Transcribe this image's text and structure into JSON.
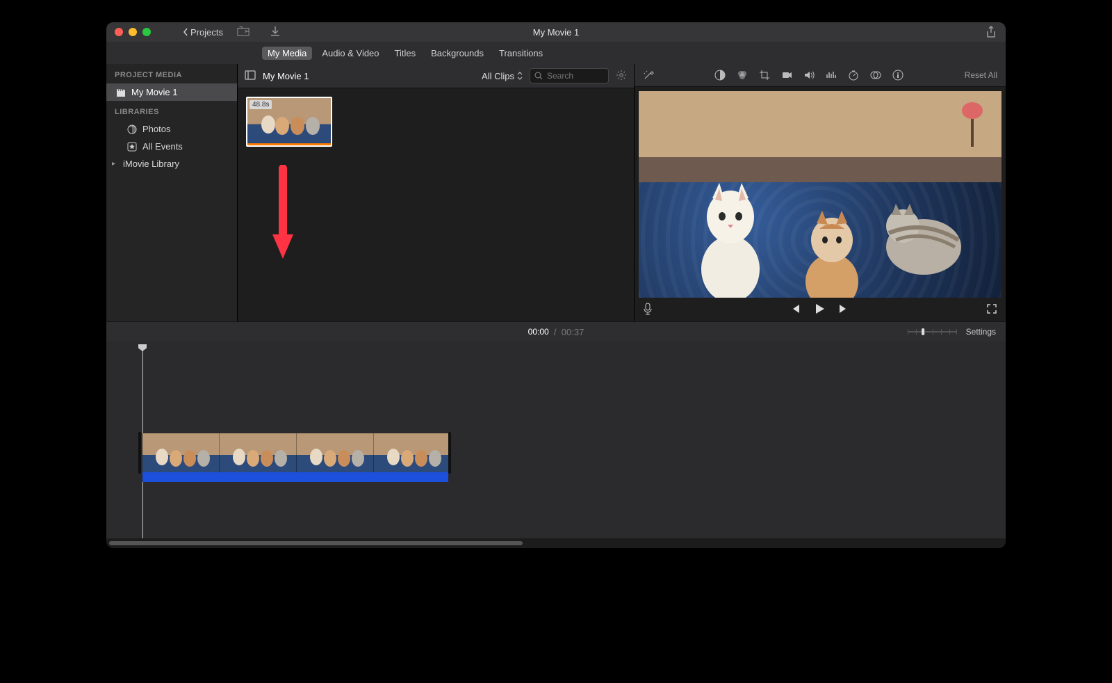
{
  "window": {
    "title": "My Movie 1",
    "back_label": "Projects"
  },
  "tabs": {
    "my_media": "My Media",
    "audio_video": "Audio & Video",
    "titles": "Titles",
    "backgrounds": "Backgrounds",
    "transitions": "Transitions"
  },
  "sidebar": {
    "heading_project": "PROJECT MEDIA",
    "project_item": "My Movie 1",
    "heading_libraries": "LIBRARIES",
    "photos": "Photos",
    "all_events": "All Events",
    "imovie_library": "iMovie Library"
  },
  "browser": {
    "breadcrumb": "My Movie 1",
    "filter_label": "All Clips",
    "search_placeholder": "Search",
    "clip_duration": "48.8s"
  },
  "adjust": {
    "reset_label": "Reset All"
  },
  "timeline": {
    "current": "00:00",
    "total": "00:37",
    "settings_label": "Settings"
  }
}
